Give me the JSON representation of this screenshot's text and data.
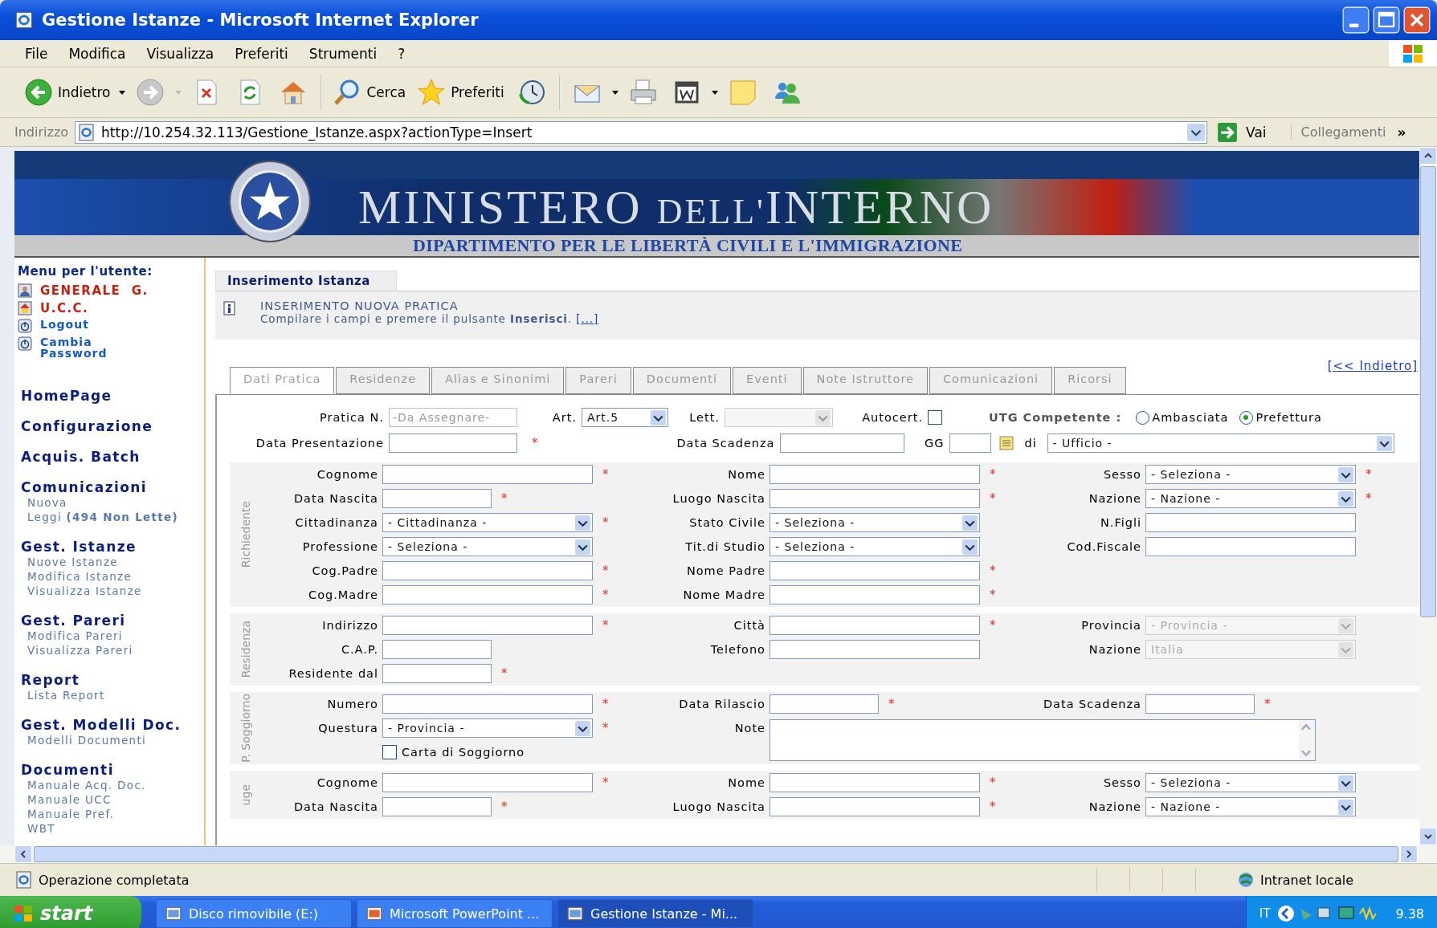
{
  "window": {
    "title": "Gestione Istanze - Microsoft Internet Explorer"
  },
  "menu": [
    "File",
    "Modifica",
    "Visualizza",
    "Preferiti",
    "Strumenti",
    "?"
  ],
  "toolbar": {
    "back": "Indietro",
    "search": "Cerca",
    "favorites": "Preferiti"
  },
  "address_bar": {
    "label": "Indirizzo",
    "url": "http://10.254.32.113/Gestione_Istanze.aspx?actionType=Insert",
    "go": "Vai",
    "links": "Collegamenti",
    "more": "»"
  },
  "banner": {
    "title_main": "MINISTERO",
    "title_small": "DELL'",
    "title_end": "INTERNO",
    "subtitle": "DIPARTIMENTO PER LE LIBERTÀ CIVILI E L'IMMIGRAZIONE"
  },
  "sidebar": {
    "heading": "Menu per l'utente:",
    "user_items": [
      {
        "text": "GENERALE  G.",
        "kind": "user"
      },
      {
        "text": "U.C.C.",
        "kind": "office"
      },
      {
        "text": "Logout",
        "kind": "link"
      },
      {
        "text": "Cambia Password",
        "kind": "link"
      }
    ],
    "sections": [
      {
        "title": "HomePage"
      },
      {
        "title": "Configurazione"
      },
      {
        "title": "Acquis. Batch"
      },
      {
        "title": "Comunicazioni",
        "links": [
          "Nuova",
          "Leggi **(494 Non Lette)**"
        ]
      },
      {
        "title": "Gest. Istanze",
        "links": [
          "Nuove Istanze",
          "Modifica Istanze",
          "Visualizza Istanze"
        ]
      },
      {
        "title": "Gest. Pareri",
        "links": [
          "Modifica Pareri",
          "Visualizza Pareri"
        ]
      },
      {
        "title": "Report",
        "links": [
          "Lista Report"
        ]
      },
      {
        "title": "Gest. Modelli Doc.",
        "links": [
          "Modelli Documenti"
        ]
      },
      {
        "title": "Documenti",
        "links": [
          "Manuale Acq. Doc.",
          "Manuale UCC",
          "Manuale Pref.",
          "WBT"
        ]
      }
    ]
  },
  "content": {
    "section_tab": "Inserimento Istanza",
    "info": {
      "title": "INSERIMENTO NUOVA PRATICA",
      "text": "Compilare i campi e premere il pulsante **Inserisci**.",
      "link": "[...]"
    },
    "tabs": [
      {
        "label": "Dati Pratica",
        "selected": true
      },
      {
        "label": "Residenze",
        "selected": false
      },
      {
        "label": "Alias e Sinonimi",
        "selected": false
      },
      {
        "label": "Pareri",
        "selected": false
      },
      {
        "label": "Documenti",
        "selected": false
      },
      {
        "label": "Eventi",
        "selected": false
      },
      {
        "label": "Note Istruttore",
        "selected": false
      },
      {
        "label": "Comunicazioni",
        "selected": false
      },
      {
        "label": "Ricorsi",
        "selected": false
      }
    ],
    "back_link": "[<< Indietro]",
    "form": {
      "pratica": {
        "label": "Pratica N.",
        "placeholder": "-Da Assegnare-",
        "disabled": true
      },
      "art": {
        "label": "Art.",
        "value": "Art.5",
        "disabled": false
      },
      "lett": {
        "label": "Lett.",
        "disabled": true
      },
      "autocert": {
        "label": "Autocert.",
        "checked": false
      },
      "utg": {
        "label": "UTG Competente :",
        "options": [
          {
            "label": "Ambasciata",
            "selected": false
          },
          {
            "label": "Prefettura",
            "selected": true
          }
        ]
      },
      "data_presentazione": {
        "label": "Data Presentazione",
        "asterisk": "*"
      },
      "data_scadenza": {
        "label": "Data Scadenza"
      },
      "gg": {
        "label": "GG"
      },
      "di": {
        "label": "di",
        "value": "- Ufficio -"
      },
      "groups": [
        {
          "title": "Richiedente",
          "rows": [
            [
              {
                "label": "Cognome",
                "kind": "text",
                "disabled": false,
                "asterisk": "*"
              },
              {
                "label": "Nome",
                "kind": "text",
                "disabled": false,
                "asterisk": "*"
              },
              {
                "label": "Sesso",
                "kind": "select",
                "value": "- Seleziona -",
                "disabled": false,
                "asterisk": "*"
              }
            ],
            [
              {
                "label": "Data Nascita",
                "kind": "short_text",
                "disabled": false,
                "asterisk": "*"
              },
              {
                "label": "Luogo Nascita",
                "kind": "text",
                "disabled": false,
                "asterisk": "*"
              },
              {
                "label": "Nazione",
                "kind": "select",
                "value": "- Nazione -",
                "disabled": false,
                "asterisk": "*"
              }
            ],
            [
              {
                "label": "Cittadinanza",
                "kind": "select",
                "value": "- Cittadinanza -",
                "disabled": false,
                "asterisk": "*"
              },
              {
                "label": "Stato Civile",
                "kind": "select",
                "value": "- Seleziona -",
                "disabled": false
              },
              {
                "label": "N.Figli",
                "kind": "text",
                "disabled": false
              }
            ],
            [
              {
                "label": "Professione",
                "kind": "select",
                "value": "- Seleziona -",
                "disabled": false
              },
              {
                "label": "Tit.di Studio",
                "kind": "select",
                "value": "- Seleziona -",
                "disabled": false
              },
              {
                "label": "Cod.Fiscale",
                "kind": "text",
                "disabled": false
              }
            ],
            [
              {
                "label": "Cog.Padre",
                "kind": "text",
                "disabled": false,
                "asterisk": "*"
              },
              {
                "label": "Nome Padre",
                "kind": "text",
                "disabled": false,
                "asterisk": "*"
              }
            ],
            [
              {
                "label": "Cog.Madre",
                "kind": "text",
                "disabled": false,
                "asterisk": "*"
              },
              {
                "label": "Nome Madre",
                "kind": "text",
                "disabled": false,
                "asterisk": "*"
              }
            ]
          ]
        },
        {
          "title": "Residenza",
          "rows": [
            [
              {
                "label": "Indirizzo",
                "kind": "text",
                "disabled": false,
                "asterisk": "*"
              },
              {
                "label": "Città",
                "kind": "text",
                "disabled": false,
                "asterisk": "*"
              },
              {
                "label": "Provincia",
                "kind": "select",
                "value": "- Provincia -",
                "disabled": true
              }
            ],
            [
              {
                "label": "C.A.P.",
                "kind": "short_text",
                "disabled": false
              },
              {
                "label": "Telefono",
                "kind": "text",
                "disabled": false
              },
              {
                "label": "Nazione",
                "kind": "select",
                "value": "Italia",
                "disabled": true
              }
            ],
            [
              {
                "label": "Residente dal",
                "kind": "short_text",
                "disabled": false,
                "asterisk": "*"
              }
            ]
          ]
        },
        {
          "title": "P. Soggiorno",
          "rows": [
            [
              {
                "label": "Numero",
                "kind": "text",
                "disabled": false,
                "asterisk": "*"
              },
              {
                "label": "Data Rilascio",
                "kind": "short_text",
                "disabled": false,
                "asterisk": "*"
              },
              {
                "label": "Data Scadenza",
                "kind": "short_text",
                "disabled": false,
                "asterisk": "*"
              }
            ],
            [
              {
                "label": "Questura",
                "kind": "select",
                "value": "- Provincia -",
                "disabled": false,
                "asterisk": "*"
              },
              {
                "label": "Note",
                "kind": "textarea",
                "disabled": false
              }
            ],
            [
              {
                "label": "Carta di Soggiorno",
                "kind": "checkbox",
                "checked": false,
                "disabled": false
              }
            ]
          ]
        },
        {
          "title": "uge",
          "rows": [
            [
              {
                "label": "Cognome",
                "kind": "text",
                "disabled": false,
                "asterisk": "*"
              },
              {
                "label": "Nome",
                "kind": "text",
                "disabled": false,
                "asterisk": "*"
              },
              {
                "label": "Sesso",
                "kind": "select",
                "value": "- Seleziona -",
                "disabled": false
              }
            ],
            [
              {
                "label": "Data Nascita",
                "kind": "short_text",
                "disabled": false,
                "asterisk": "*"
              },
              {
                "label": "Luogo Nascita",
                "kind": "text",
                "disabled": false,
                "asterisk": "*"
              },
              {
                "label": "Nazione",
                "kind": "select",
                "value": "- Nazione -",
                "disabled": false
              }
            ]
          ]
        }
      ]
    }
  },
  "status_bar": {
    "text": "Operazione completata",
    "zone": "Intranet locale"
  },
  "taskbar": {
    "start": "start",
    "tasks": [
      {
        "label": "Disco rimovibile (E:)",
        "selected": false
      },
      {
        "label": "Microsoft PowerPoint ...",
        "selected": false
      },
      {
        "label": "Gestione Istanze - Mi...",
        "selected": true
      }
    ],
    "language": "IT",
    "clock": "9.38"
  }
}
